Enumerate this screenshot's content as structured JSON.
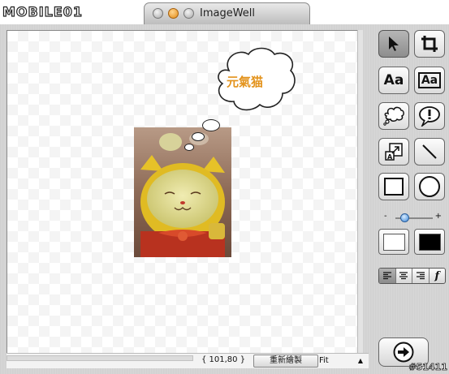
{
  "header": {
    "logo_text": "MOBILE01",
    "window_title": "ImageWell"
  },
  "canvas": {
    "thought_bubble_text": "元氣猫",
    "photo_subject": "lucky-cat-plush"
  },
  "status_bar": {
    "coordinates": "{ 101,80 }",
    "redraw_button": "重新繪製",
    "zoom_select": "Fit"
  },
  "palette": {
    "tools": [
      {
        "name": "select-arrow",
        "icon": "arrow-icon",
        "active": true
      },
      {
        "name": "crop",
        "icon": "crop-icon",
        "active": false
      },
      {
        "name": "text",
        "label": "Aa",
        "active": false
      },
      {
        "name": "boxed-text",
        "label": "Aa",
        "active": false
      },
      {
        "name": "thought-balloon",
        "icon": "thought-balloon-icon",
        "active": false
      },
      {
        "name": "speech-balloon",
        "icon": "exclamation-balloon-icon",
        "active": false
      },
      {
        "name": "resize",
        "icon": "resize-icon",
        "active": false
      },
      {
        "name": "line",
        "icon": "line-icon",
        "active": false
      },
      {
        "name": "rectangle",
        "icon": "rectangle-icon",
        "active": false
      },
      {
        "name": "ellipse",
        "icon": "circle-icon",
        "active": false
      }
    ],
    "slider": {
      "minus_label": "-",
      "plus_label": "+",
      "level": 0.25
    },
    "fill_color": "#ffffff",
    "stroke_color": "#000000",
    "align_italic_label": "f"
  },
  "watermark": "#51411",
  "colors": {
    "bubble_text": "#e3931c",
    "slider_knob": "#3a86d8"
  }
}
